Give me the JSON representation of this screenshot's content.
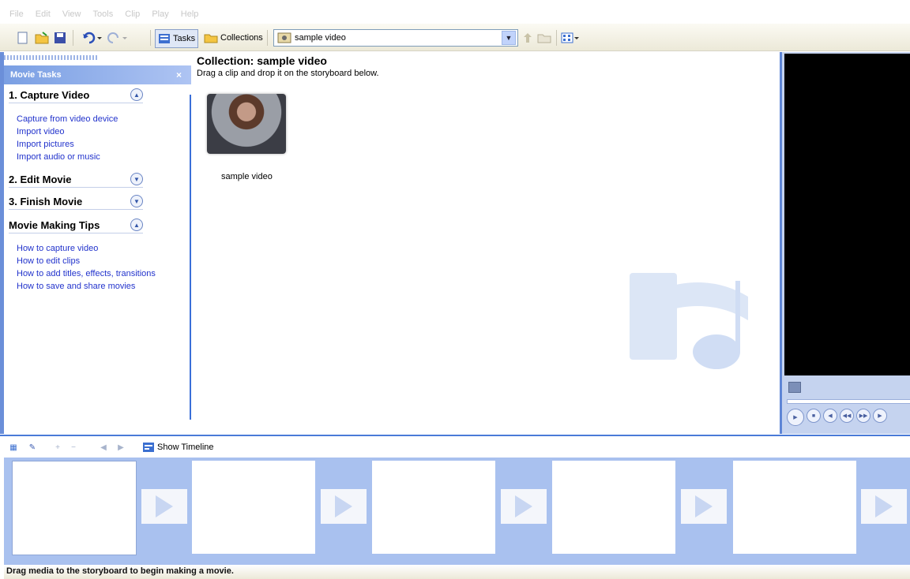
{
  "menu": [
    "File",
    "Edit",
    "View",
    "Tools",
    "Clip",
    "Play",
    "Help"
  ],
  "toolbar": {
    "tasks_label": "Tasks",
    "collections_label": "Collections",
    "collection_combo_value": "sample video"
  },
  "taskpane": {
    "header": "Movie Tasks",
    "close": "×",
    "sections": [
      {
        "title": "1. Capture Video",
        "expanded": true
      },
      {
        "title": "2. Edit Movie",
        "expanded": false
      },
      {
        "title": "3. Finish Movie",
        "expanded": false
      },
      {
        "title": "Movie Making Tips",
        "expanded": true
      }
    ],
    "capture_links": [
      "Capture from video device",
      "Import video",
      "Import pictures",
      "Import audio or music"
    ],
    "tips_links": [
      "How to capture video",
      "How to edit clips",
      "How to add titles, effects, transitions",
      "How to save and share movies"
    ]
  },
  "collection": {
    "title": "Collection: sample video",
    "subtitle": "Drag a clip and drop it on the storyboard below.",
    "clip_caption": "sample video"
  },
  "storyboard": {
    "show_timeline_label": "Show Timeline",
    "status_text": "Drag media to the storyboard to begin making a movie."
  },
  "colors": {
    "accent": "#3a6fd8",
    "storyboard_bg": "#a9c1ef",
    "link": "#2233cc"
  }
}
